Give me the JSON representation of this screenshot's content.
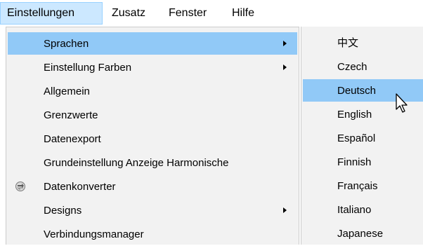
{
  "menubar": {
    "items": [
      {
        "label": "Einstellungen"
      },
      {
        "label": "Zusatz"
      },
      {
        "label": "Fenster"
      },
      {
        "label": "Hilfe"
      }
    ]
  },
  "dropdown": {
    "items": [
      {
        "label": "Sprachen"
      },
      {
        "label": "Einstellung Farben"
      },
      {
        "label": "Allgemein"
      },
      {
        "label": "Grenzwerte"
      },
      {
        "label": "Datenexport"
      },
      {
        "label": "Grundeinstellung Anzeige Harmonische"
      },
      {
        "label": "Datenkonverter"
      },
      {
        "label": "Designs"
      },
      {
        "label": "Verbindungsmanager"
      }
    ]
  },
  "submenu": {
    "items": [
      {
        "label": "中文"
      },
      {
        "label": "Czech"
      },
      {
        "label": "Deutsch"
      },
      {
        "label": "English"
      },
      {
        "label": "Español"
      },
      {
        "label": "Finnish"
      },
      {
        "label": "Français"
      },
      {
        "label": "Italiano"
      },
      {
        "label": "Japanese"
      }
    ]
  },
  "colors": {
    "highlight": "#91c9f7",
    "menu_active": "#cce8ff",
    "menu_bg": "#f2f2f2"
  },
  "icons": {
    "submenu_arrow": "chevron-right-icon",
    "converter": "converter-icon",
    "pointer": "mouse-pointer-icon"
  }
}
